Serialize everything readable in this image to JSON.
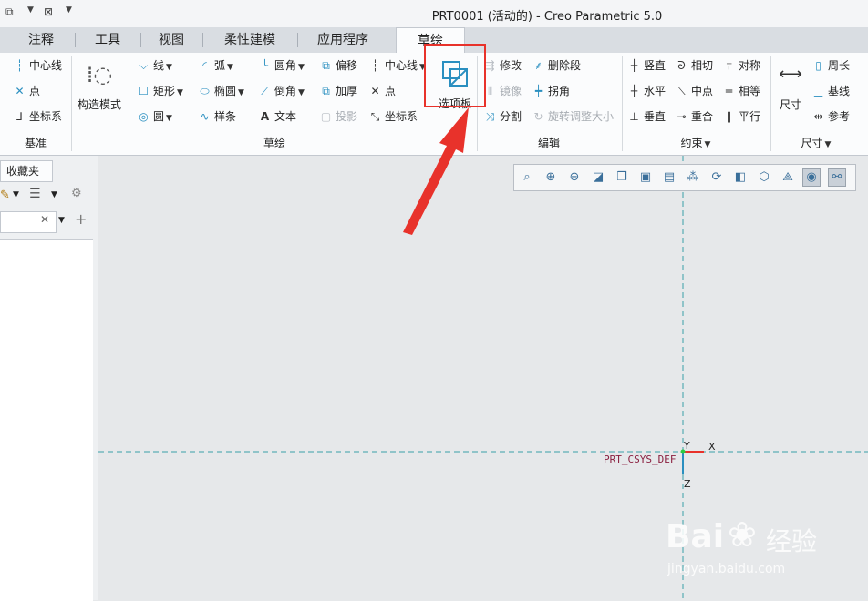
{
  "window": {
    "title": "PRT0001 (活动的) - Creo Parametric 5.0"
  },
  "tabs": [
    {
      "label": "注释"
    },
    {
      "label": "工具"
    },
    {
      "label": "视图"
    },
    {
      "label": "柔性建模"
    },
    {
      "label": "应用程序"
    },
    {
      "label": "草绘",
      "active": true
    }
  ],
  "ribbon": {
    "datum": {
      "group_label": "基准",
      "items": [
        "中心线",
        "点",
        "坐标系"
      ]
    },
    "construction_mode_label": "构造模式",
    "sketch": {
      "group_label": "草绘",
      "col1": [
        "线",
        "矩形",
        "圆"
      ],
      "col2": [
        "弧",
        "椭圆",
        "样条"
      ],
      "col3": [
        "圆角",
        "倒角",
        "文本"
      ],
      "col4": [
        "偏移",
        "加厚",
        "投影"
      ],
      "col5": [
        "中心线",
        "点",
        "坐标系"
      ],
      "palette_label": "选项板"
    },
    "edit": {
      "group_label": "编辑",
      "items": [
        "修改",
        "删除段",
        "镜像",
        "拐角",
        "分割",
        "旋转调整大小"
      ]
    },
    "constraint": {
      "group_label": "约束",
      "items": [
        "竖直",
        "相切",
        "对称",
        "水平",
        "中点",
        "相等",
        "垂直",
        "重合",
        "平行"
      ]
    },
    "dimension": {
      "group_label": "尺寸",
      "big_label": "尺寸",
      "items": [
        "周长",
        "基线",
        "参考"
      ]
    }
  },
  "left_panel": {
    "tab_label": "收藏夹"
  },
  "canvas": {
    "csys_label": "PRT_CSYS_DEF",
    "axis_x": "X",
    "axis_y": "Y",
    "axis_z": "Z"
  },
  "watermark": {
    "brand": "Bai",
    "brand_cn": "经验",
    "url": "jingyan.baidu.com"
  },
  "colors": {
    "accent": "#2a8fc0",
    "highlight": "#e8322b",
    "axis_line": "#3aa0a8"
  }
}
